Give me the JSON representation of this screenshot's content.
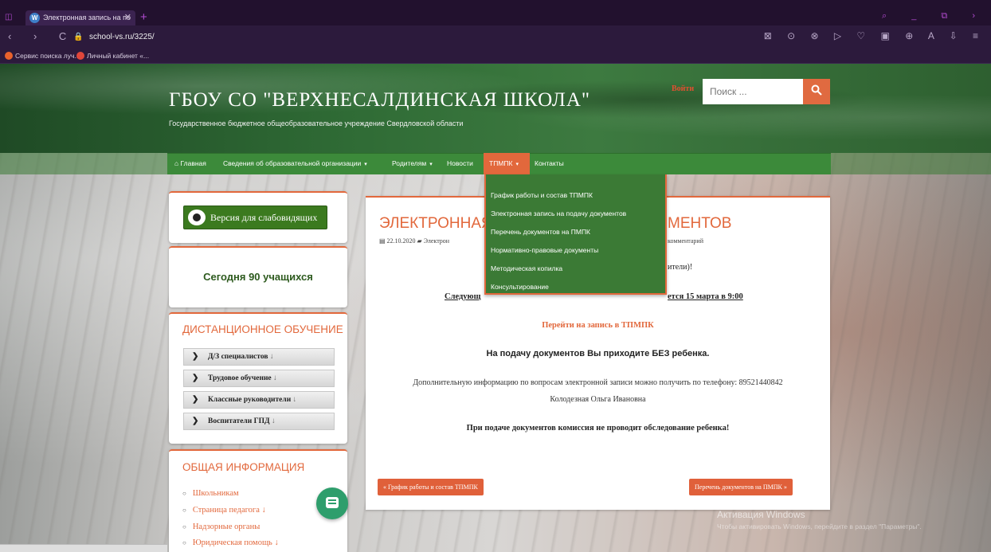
{
  "browser": {
    "tab_title": "Электронная запись на по",
    "tab_close": "✕",
    "new_tab": "+",
    "url": "school-vs.ru/3225/",
    "nav_glyphs": "‹ › C",
    "toolbar_glyphs": "⊠ ⊙ ⊗ ▷ ♡ ▣ ⊕ A ⇩ ≡",
    "window_glyphs": "⌕ _ ⧉ ›",
    "bookmarks": [
      {
        "label": "Сервис поиска луч...",
        "color": "#e8622c"
      },
      {
        "label": "Личный кабинет «...",
        "color": "#e0463a"
      }
    ]
  },
  "header": {
    "title": "ГБОУ СО \"ВЕРХНЕСАЛДИНСКАЯ ШКОЛА\"",
    "subtitle": "Государственное бюджетное общеобразовательное учреждение Свердловской области",
    "login": "Войти",
    "search_placeholder": "Поиск ...",
    "search_icon": "search-icon"
  },
  "nav": {
    "items": [
      {
        "label": "Главная",
        "has_home_icon": true
      },
      {
        "label": "Сведения об образовательной организации",
        "caret": "▾"
      },
      {
        "label": "Родителям",
        "caret": "▾"
      },
      {
        "label": "Новости"
      },
      {
        "label": "ТПМПК",
        "caret": "▾",
        "active": true
      },
      {
        "label": "Контакты"
      }
    ],
    "home_glyph": "⌂",
    "active_color": "#e2683c"
  },
  "dropdown": {
    "items": [
      "График работы и состав ТПМПК",
      "Электронная запись на подачу документов",
      "Перечень документов на ПМПК",
      "Нормативно-правовые документы",
      "Методическая копилка",
      "Консультирование"
    ]
  },
  "sidebar": {
    "vision_button": "Версия для слабовидящих",
    "today": "Сегодня 90 учащихся",
    "distance": {
      "title": "ДИСТАНЦИОННОЕ ОБУЧЕНИЕ",
      "items": [
        "Д/З специалистов",
        "Трудовое обучение",
        "Классные руководители",
        "Воспитатели ГПД"
      ],
      "chevron": "❯",
      "arrow": "↓"
    },
    "general": {
      "title": "ОБЩАЯ ИНФОРМАЦИЯ",
      "items": [
        "Школьникам",
        "Страница педагога ↓",
        "Надзорные органы",
        "Юридическая помощь ↓"
      ],
      "bullet": "○"
    }
  },
  "article": {
    "title_left": "ЭЛЕКТРОННАЯ",
    "title_right": "МЕНТОВ",
    "meta_left": "▤ 22.10.2020   ▰ Электрон",
    "meta_right": "комментарий",
    "greeting_right": "ители)!",
    "next_left": "Следующ",
    "next_right": "ется 15 марта в 9:00",
    "link": "Перейти на запись в ТПМПК",
    "no_child": "На подачу документов Вы приходите БЕЗ ребенка.",
    "info_line1": "Дополнительную информацию по вопросам электронной записи  можно получить по телефону:  89521440842",
    "info_line2": "Колодезная Ольга Ивановна",
    "commission": "При подаче документов комиссия не проводит обследование ребенка!",
    "prev_button": "« График работы и состав ТПМПК",
    "next_button": "Перечень документов на ПМПК »"
  },
  "os_watermark": {
    "line1": "Активация Windows",
    "line2": "Чтобы активировать Windows, перейдите в раздел \"Параметры\"."
  },
  "colors": {
    "accent": "#e2683c",
    "nav_green": "#3c8a3a",
    "vision_green": "#3b7a1f"
  }
}
